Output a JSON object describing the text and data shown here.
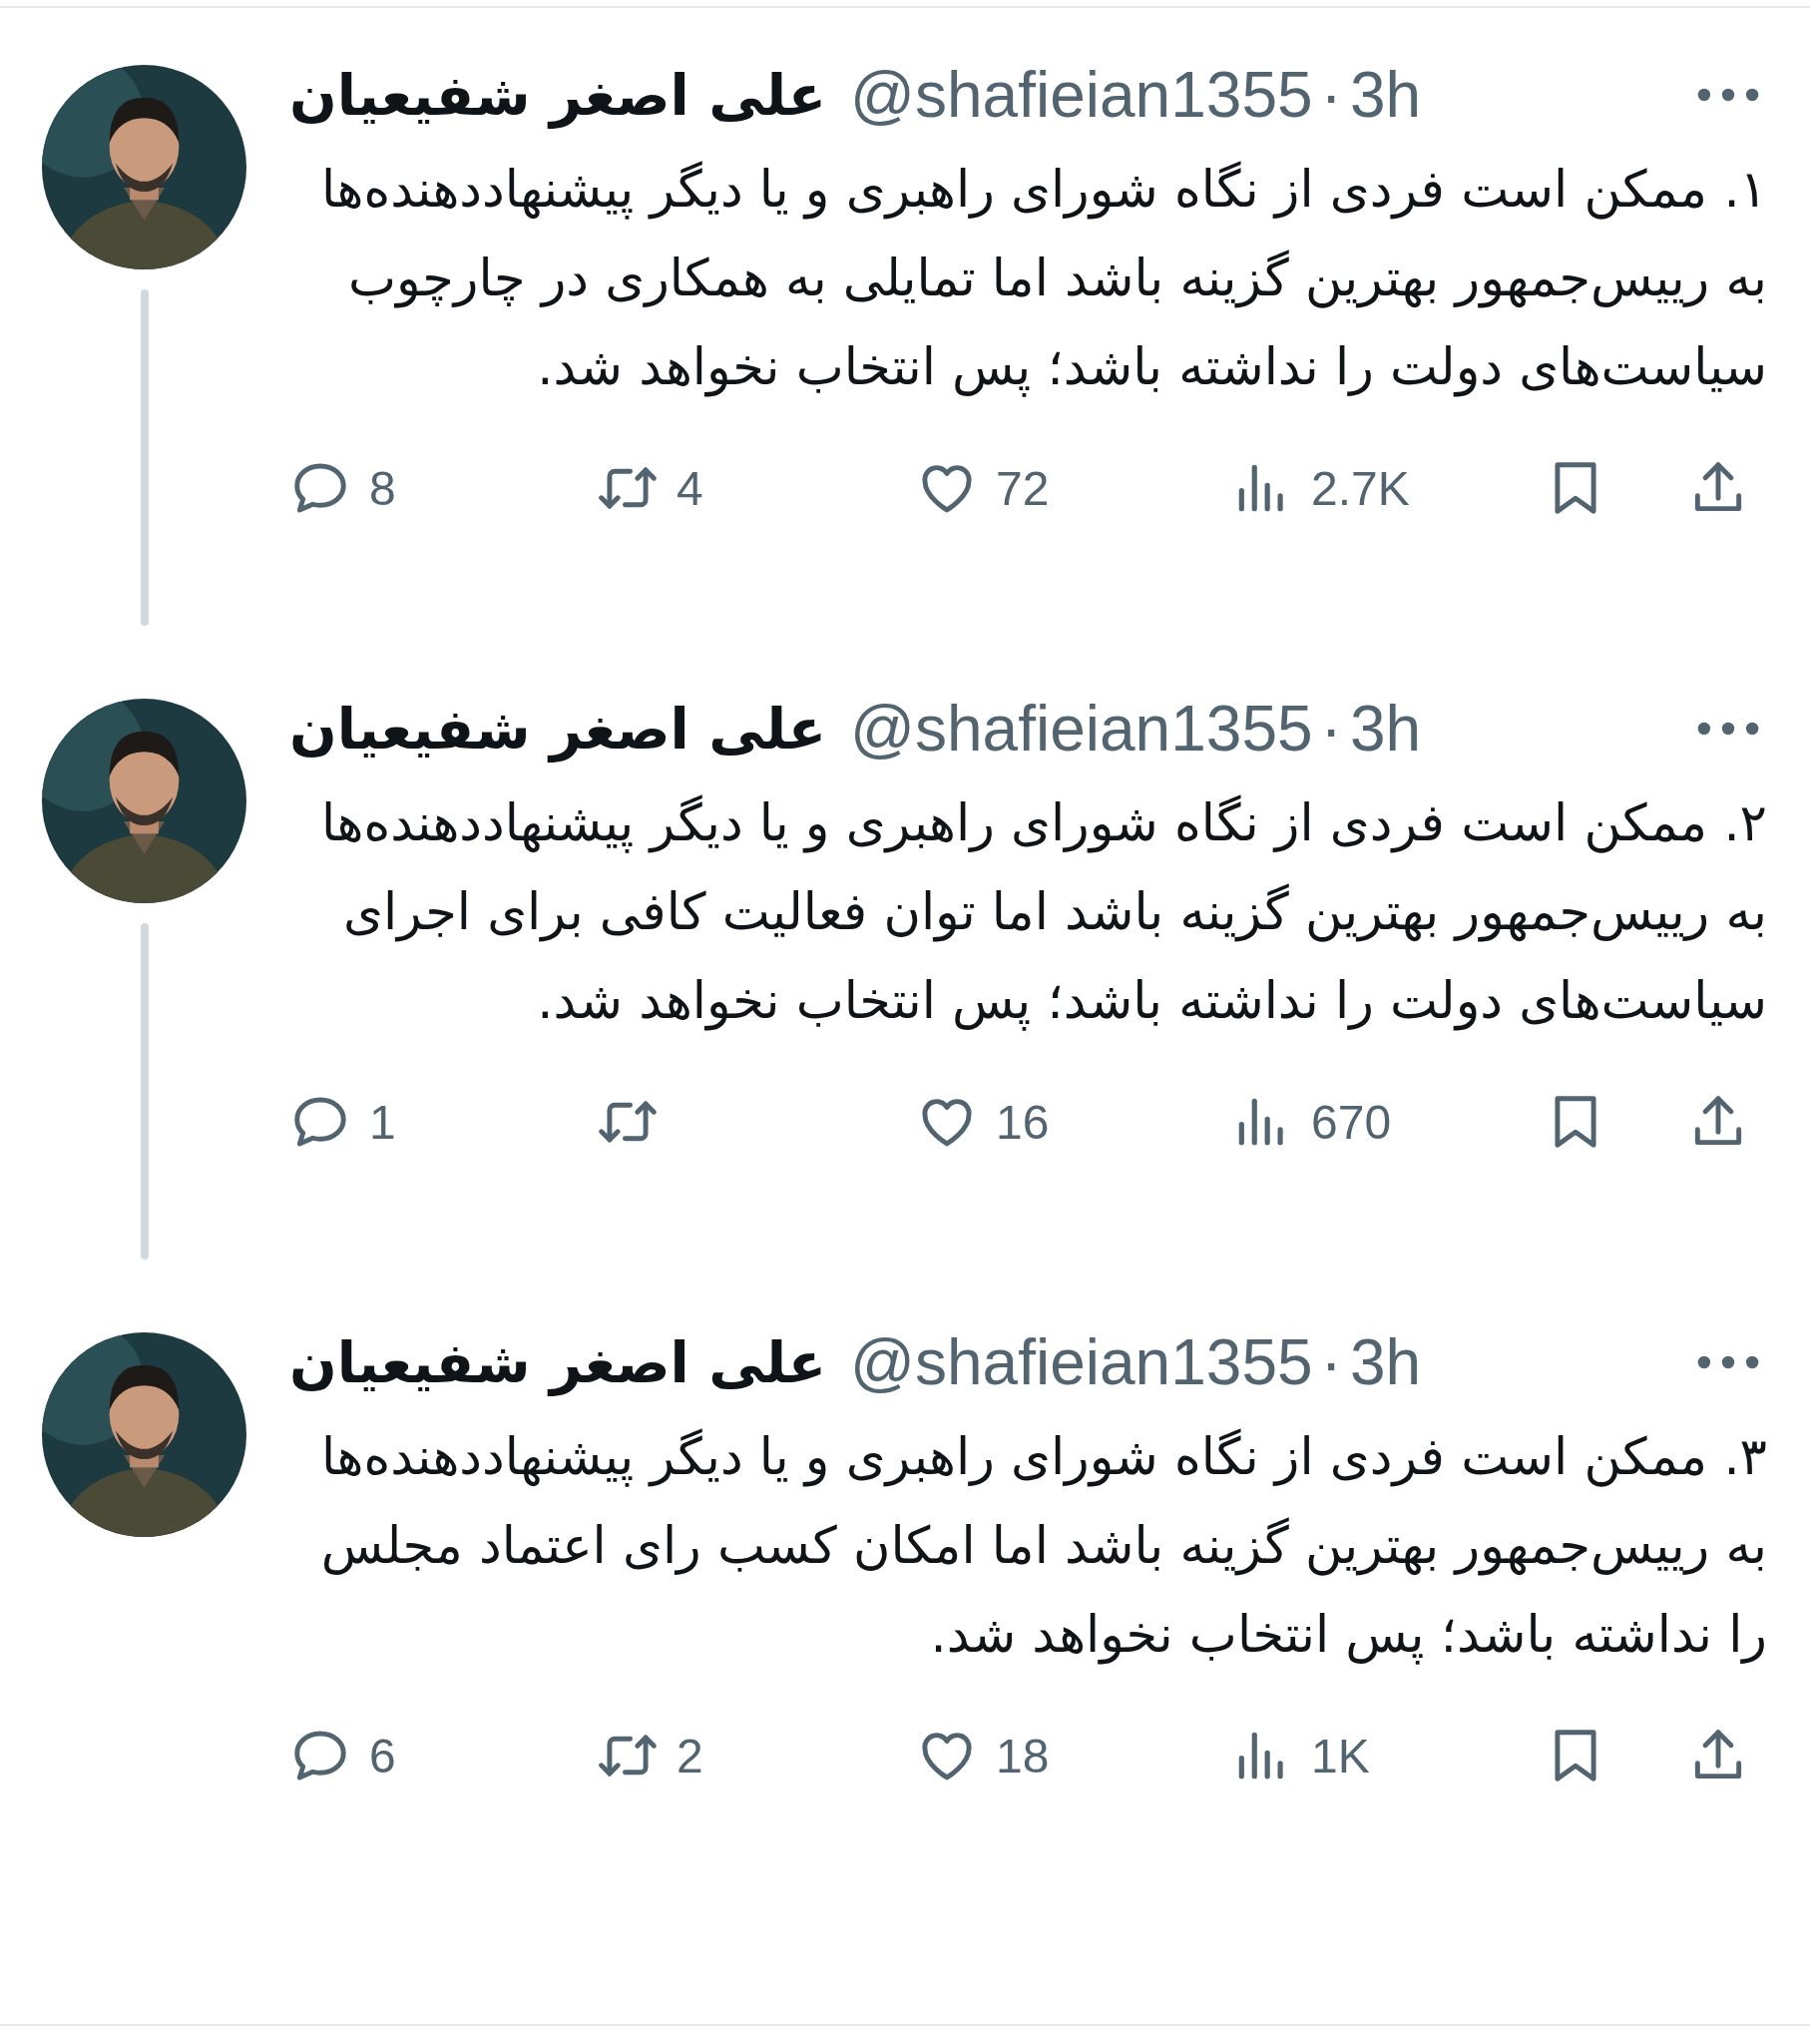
{
  "tweets": [
    {
      "author": "علی اصغر شفیعیان",
      "handle": "@shafieian1355",
      "separator": "·",
      "time": "3h",
      "thread_continues": true,
      "text": "۱. ممکن است فردی از نگاه شورای راهبری و یا دیگر پیشنهاددهنده‌ها به رییس‌جمهور بهترین گزینه باشد اما تمایلی به همکاری در چارچوب سیاست‌های دولت را نداشته باشد؛ پس انتخاب نخواهد شد.",
      "replies": "8",
      "reposts": "4",
      "likes": "72",
      "views": "2.7K"
    },
    {
      "author": "علی اصغر شفیعیان",
      "handle": "@shafieian1355",
      "separator": "·",
      "time": "3h",
      "thread_continues": true,
      "text": "۲. ممکن است فردی از نگاه شورای راهبری و یا دیگر پیشنهاددهنده‌ها به رییس‌جمهور بهترین گزینه باشد اما توان فعالیت کافی برای اجرای سیاست‌های دولت را نداشته باشد؛ پس انتخاب نخواهد شد.",
      "replies": "1",
      "likes": "16",
      "views": "670"
    },
    {
      "author": "علی اصغر شفیعیان",
      "handle": "@shafieian1355",
      "separator": "·",
      "time": "3h",
      "thread_continues": false,
      "text": "۳. ممکن است فردی از نگاه شورای راهبری و یا دیگر پیشنهاددهنده‌ها به رییس‌جمهور بهترین گزینه باشد اما امکان کسب رای اعتماد مجلس را نداشته باشد؛ پس انتخاب نخواهد شد.",
      "replies": "6",
      "reposts": "2",
      "likes": "18",
      "views": "1K"
    }
  ]
}
